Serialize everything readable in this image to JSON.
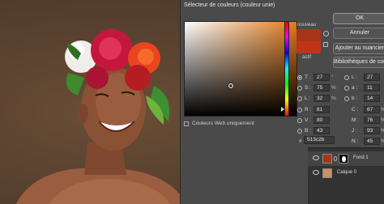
{
  "dialog": {
    "title": "Sélecteur de couleurs (couleur unie)",
    "buttons": {
      "ok": "OK",
      "cancel": "Annuler",
      "add_swatch": "Ajouter au nuancier",
      "libraries": "Bibliothèques de couleurs"
    },
    "new_label": "nouveau",
    "current_label": "actif",
    "colors": {
      "new": "#a8341a",
      "current": "#bf3318"
    },
    "web_only_label": "Couleurs Web uniquement",
    "hsb": [
      {
        "label": "T :",
        "value": "27",
        "unit": "°",
        "selected": true
      },
      {
        "label": "S :",
        "value": "75",
        "unit": "%",
        "selected": false
      },
      {
        "label": "L :",
        "value": "32",
        "unit": "%",
        "selected": false
      }
    ],
    "rgb": [
      {
        "label": "R :",
        "value": "81"
      },
      {
        "label": "V :",
        "value": "80"
      },
      {
        "label": "B :",
        "value": "43"
      }
    ],
    "lab": [
      {
        "label": "L :",
        "value": "27"
      },
      {
        "label": "a :",
        "value": "11"
      },
      {
        "label": "b :",
        "value": "14"
      }
    ],
    "cmyk": [
      {
        "label": "C :",
        "value": "67",
        "unit": "%"
      },
      {
        "label": "M :",
        "value": "76",
        "unit": "%"
      },
      {
        "label": "J :",
        "value": "93",
        "unit": "%"
      },
      {
        "label": "N :",
        "value": "45",
        "unit": "%"
      }
    ],
    "hex_label": "#",
    "hex": "513c2b"
  },
  "layers": {
    "items": [
      {
        "name": "Fond 1"
      },
      {
        "name": "Calque 0"
      }
    ]
  }
}
